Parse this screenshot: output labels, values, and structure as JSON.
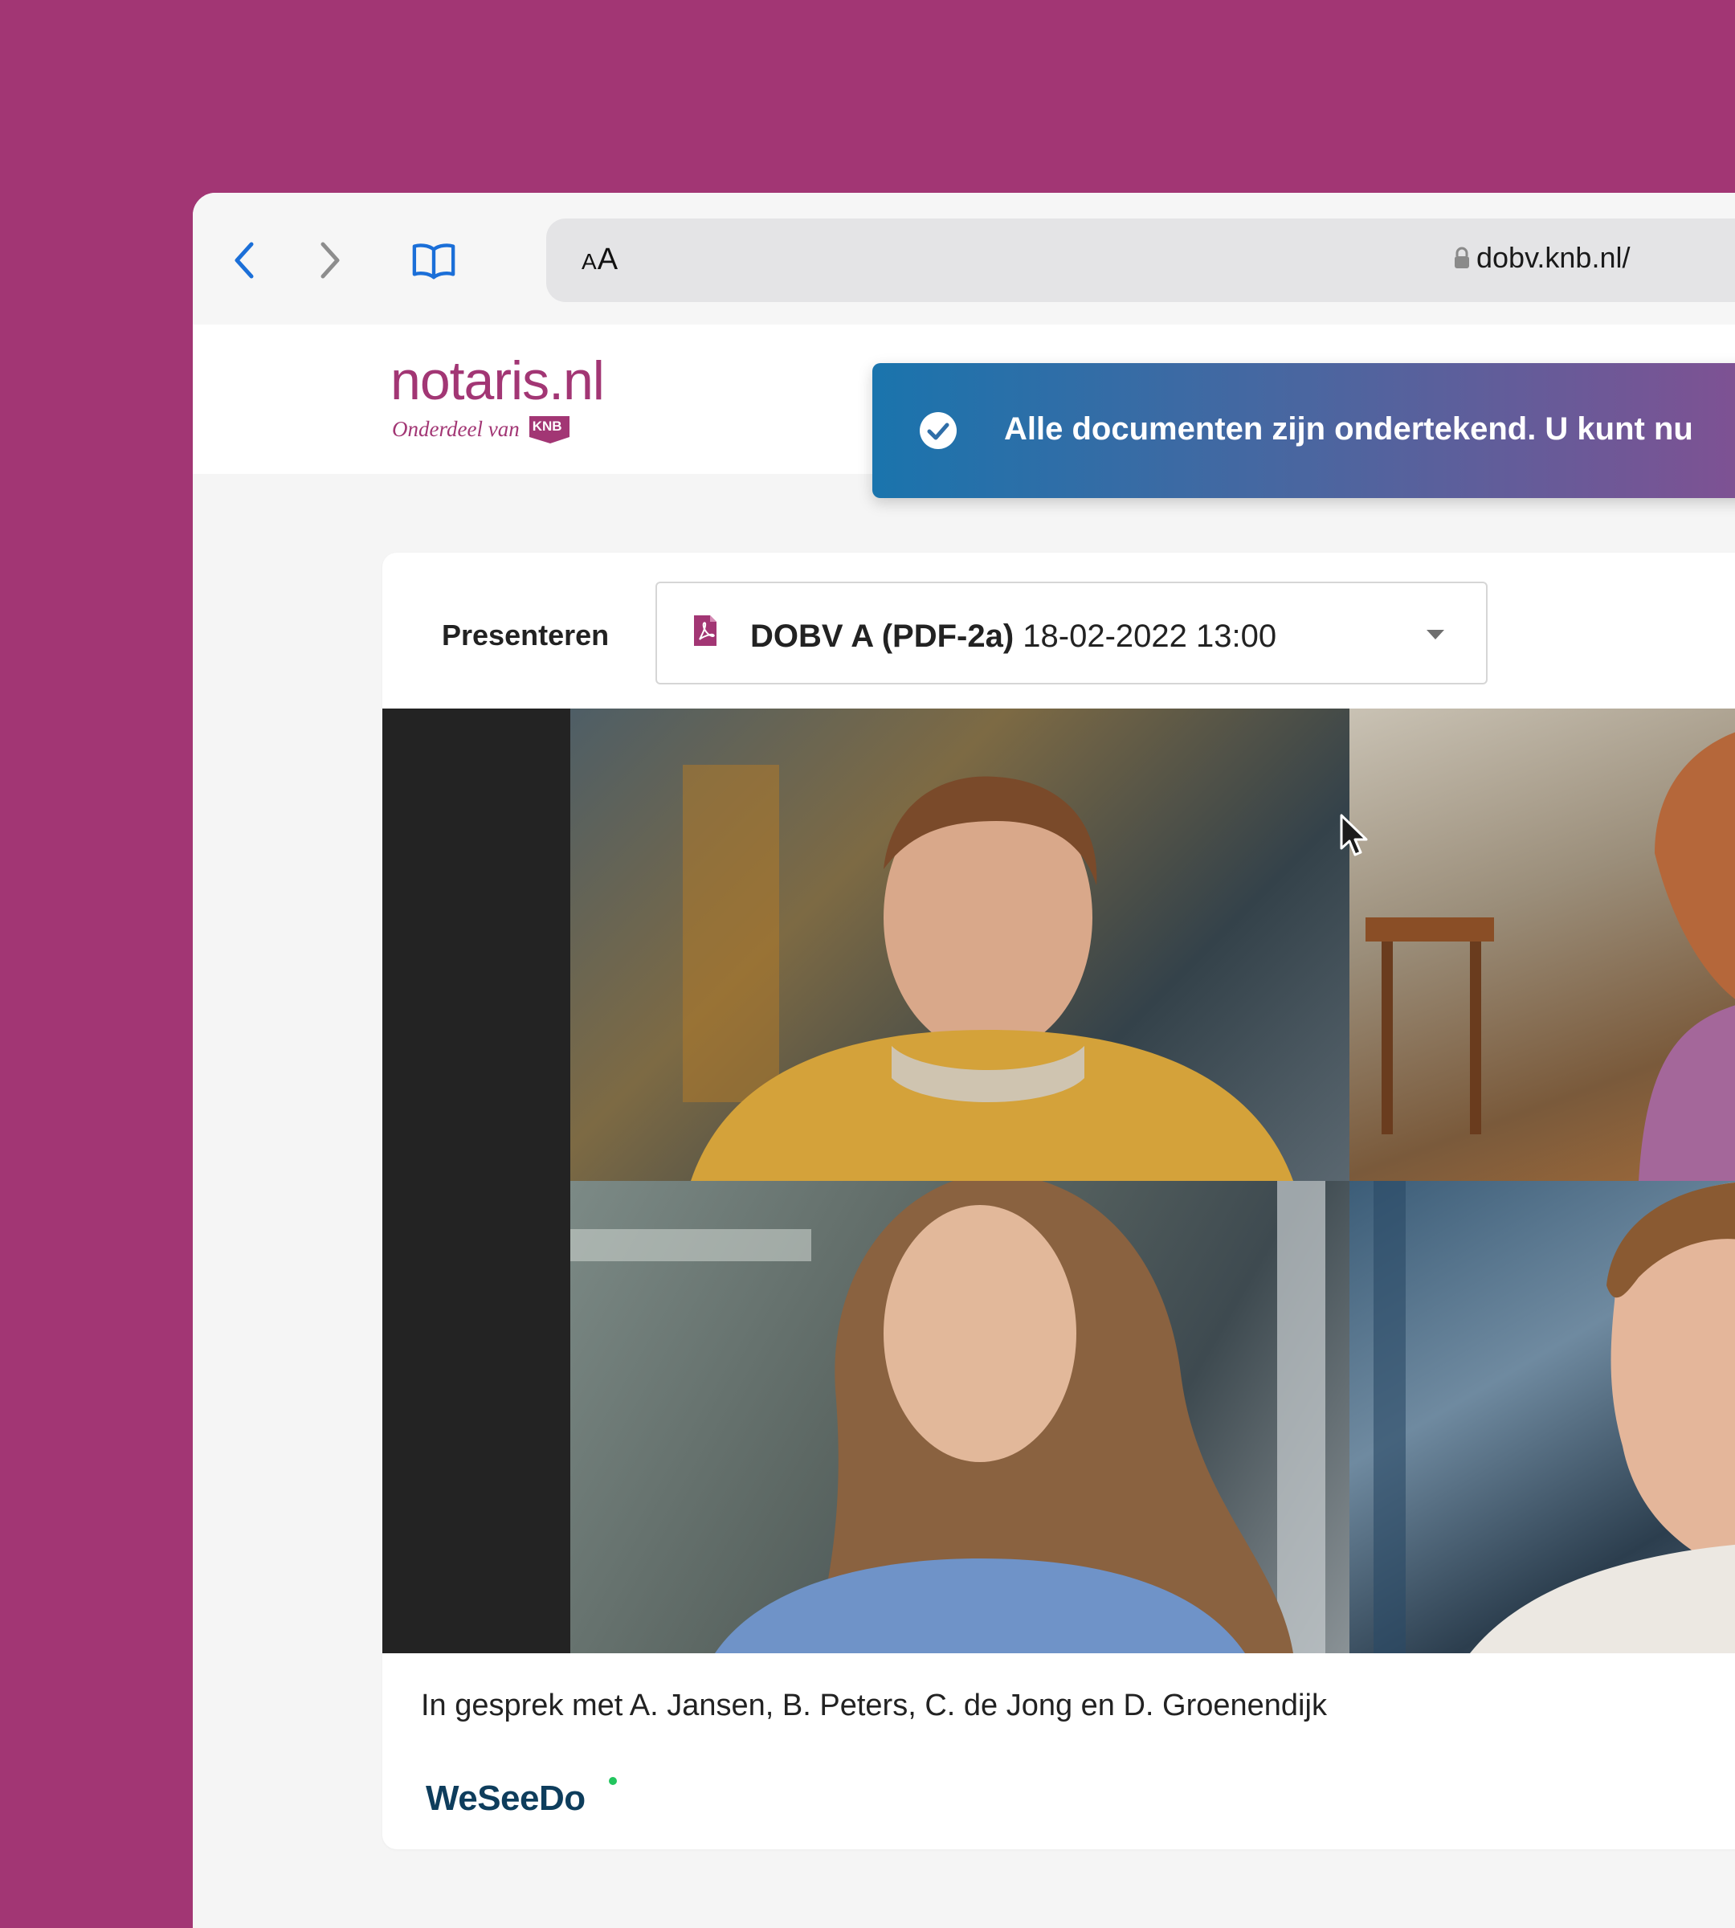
{
  "browser": {
    "aa_label_small": "A",
    "aa_label_large": "A",
    "url": "dobv.knb.nl/",
    "icons": {
      "back": "chevron-left-icon",
      "forward": "chevron-right-icon",
      "bookmarks": "book-icon",
      "lock": "lock-icon"
    }
  },
  "header": {
    "logo_text": "notaris.nl",
    "logo_subtitle": "Onderdeel van",
    "logo_badge": "KNB"
  },
  "toast": {
    "message": "Alle documenten zijn ondertekend. U kunt nu",
    "icon": "check-circle-icon"
  },
  "presenter": {
    "label": "Presenteren",
    "document_name": "DOBV A (PDF-2a)",
    "document_datetime": "18-02-2022 13:00",
    "icon": "pdf-file-icon"
  },
  "video": {
    "caption": "In gesprek met A. Jansen, B. Peters, C. de Jong en D. Groenendijk"
  },
  "footer": {
    "brand": "WeSeeDo"
  },
  "colors": {
    "background": "#a23674",
    "brand": "#a23674",
    "toast_start": "#1a74ad",
    "toast_end": "#8a4d90",
    "weseedo": "#0e3d5c",
    "weseedo_dot": "#22c55e"
  }
}
